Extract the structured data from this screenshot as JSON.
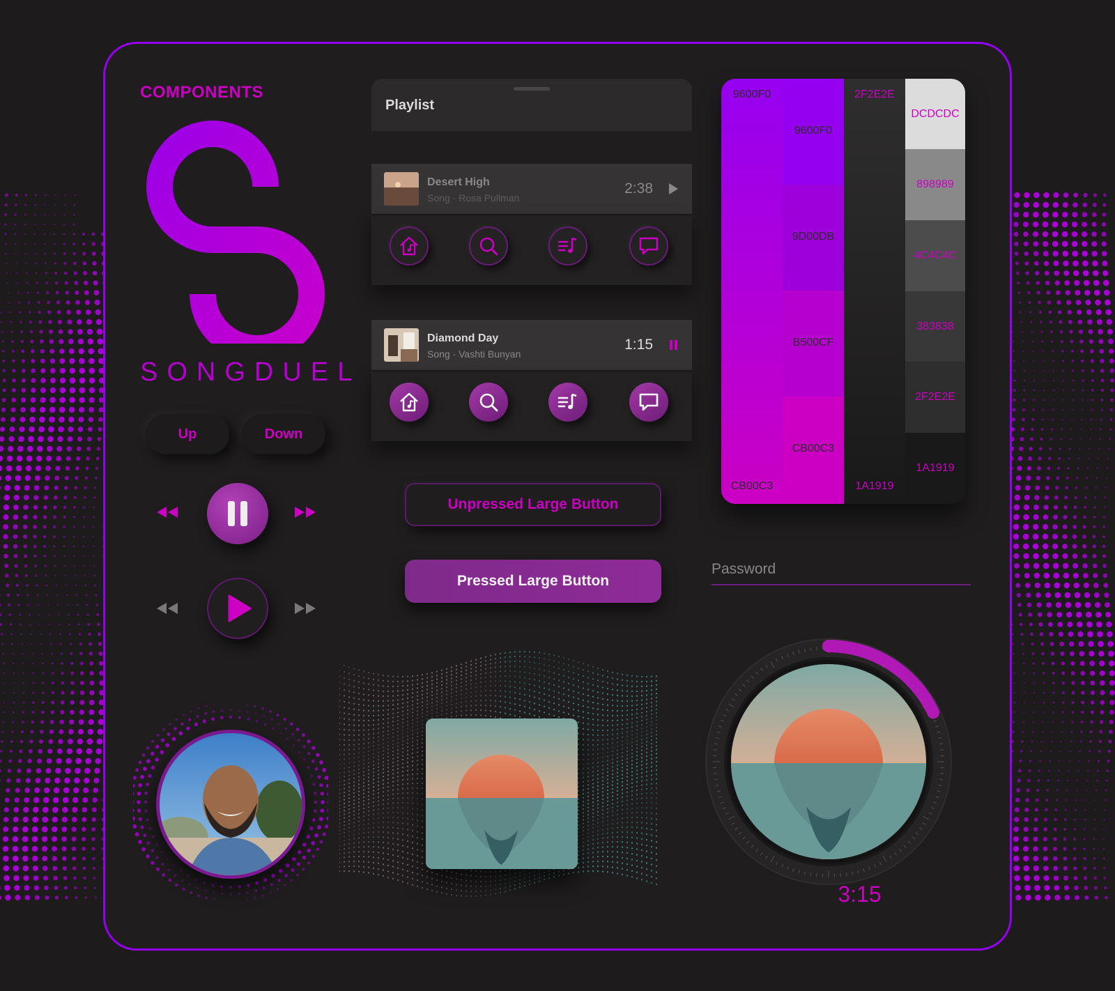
{
  "title": "COMPONENTS",
  "brand": {
    "name": "SONGDUEL"
  },
  "vote": {
    "up_label": "Up",
    "down_label": "Down"
  },
  "playlist": {
    "header_label": "Playlist",
    "tracks": [
      {
        "name": "Desert High",
        "subtitle": "Song · Rosa Pullman",
        "time": "2:38",
        "state": "play"
      },
      {
        "name": "Diamond Day",
        "subtitle": "Song · Vashti Bunyan",
        "time": "1:15",
        "state": "pause"
      }
    ],
    "nav_icons": [
      "home-icon",
      "search-icon",
      "playlist-icon",
      "chat-icon"
    ]
  },
  "buttons": {
    "unpressed_label": "Unpressed Large Button",
    "pressed_label": "Pressed Large Button"
  },
  "palette": {
    "columns": [
      {
        "top_label": "9600F0",
        "bottom_label": "CB00C3",
        "gradient": [
          "#9600f0",
          "#cb00c3"
        ]
      },
      {
        "swatches": [
          "9600F0",
          "9D00DB",
          "B500CF",
          "CB00C3"
        ],
        "colors": [
          "#9600f0",
          "#9d00db",
          "#b500cf",
          "#cb00c3"
        ]
      },
      {
        "top_label": "2F2E2E",
        "bottom_label": "1A1919",
        "gradient": [
          "#2f2e2e",
          "#1a1919"
        ]
      },
      {
        "swatches": [
          "DCDCDC",
          "898989",
          "4C4C4C",
          "383838",
          "2F2E2E",
          "1A1919"
        ],
        "colors": [
          "#dcdcdc",
          "#898989",
          "#4c4c4c",
          "#383838",
          "#2f2e2e",
          "#1a1919"
        ]
      }
    ]
  },
  "password": {
    "placeholder": "Password"
  },
  "dial": {
    "time": "3:15",
    "progress": 0.18
  },
  "colors": {
    "accent": "#cb00c3",
    "primary": "#9600f0",
    "background": "#1f1d1e"
  }
}
